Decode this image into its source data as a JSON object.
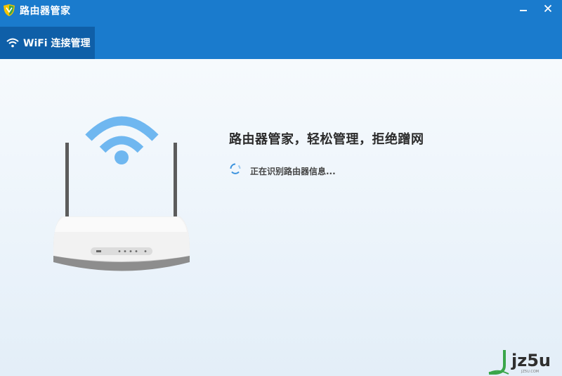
{
  "window": {
    "title": "路由器管家",
    "minimize_label": "minimize",
    "close_label": "close"
  },
  "tabs": [
    {
      "label": "WiFi 连接管理",
      "icon": "wifi-icon",
      "active": true
    }
  ],
  "main": {
    "headline": "路由器管家，轻松管理，拒绝蹭网",
    "status": "正在识别路由器信息...",
    "illustration": "router-icon"
  },
  "watermark": {
    "text": "jz5u",
    "sub": "JZ5U.COM"
  },
  "colors": {
    "titlebar": "#1a7bcd",
    "tab_active": "#0f5fa8",
    "wifi_signal": "#6fb7f0",
    "spinner": "#3a92de",
    "watermark_green": "#3aa64a"
  }
}
